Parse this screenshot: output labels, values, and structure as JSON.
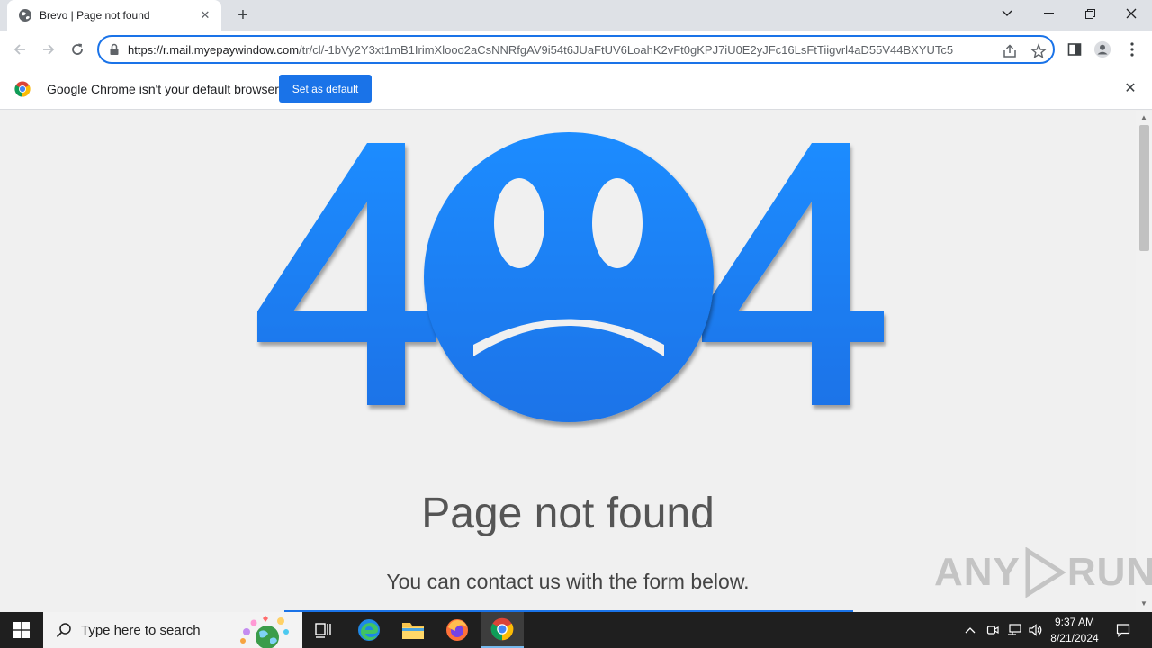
{
  "browser": {
    "tab": {
      "title": "Brevo | Page not found",
      "close_glyph": "✕"
    },
    "new_tab_glyph": "+",
    "url_host": "https://r.mail.myepaywindow.com",
    "url_path": "/tr/cl/-1bVy2Y3xt1mB1IrimXlooo2aCsNNRfgAV9i54t6JUaFtUV6LoahK2vFt0gKPJ7iU0E2yJFc16LsFtTiigvrl4aD55V44BXYUTc5",
    "window_controls": {
      "chevron": "⌄",
      "minimize": "─",
      "restore": "❐",
      "close": "✕"
    }
  },
  "infobar": {
    "message": "Google Chrome isn't your default browser",
    "button": "Set as default",
    "close_glyph": "✕"
  },
  "page": {
    "heading": "Page not found",
    "subtext": "You can contact us with the form below.",
    "accent_color": "#1a73e8"
  },
  "watermark": {
    "left": "ANY",
    "right": "RUN"
  },
  "taskbar": {
    "search_placeholder": "Type here to search",
    "time": "9:37 AM",
    "date": "8/21/2024"
  }
}
